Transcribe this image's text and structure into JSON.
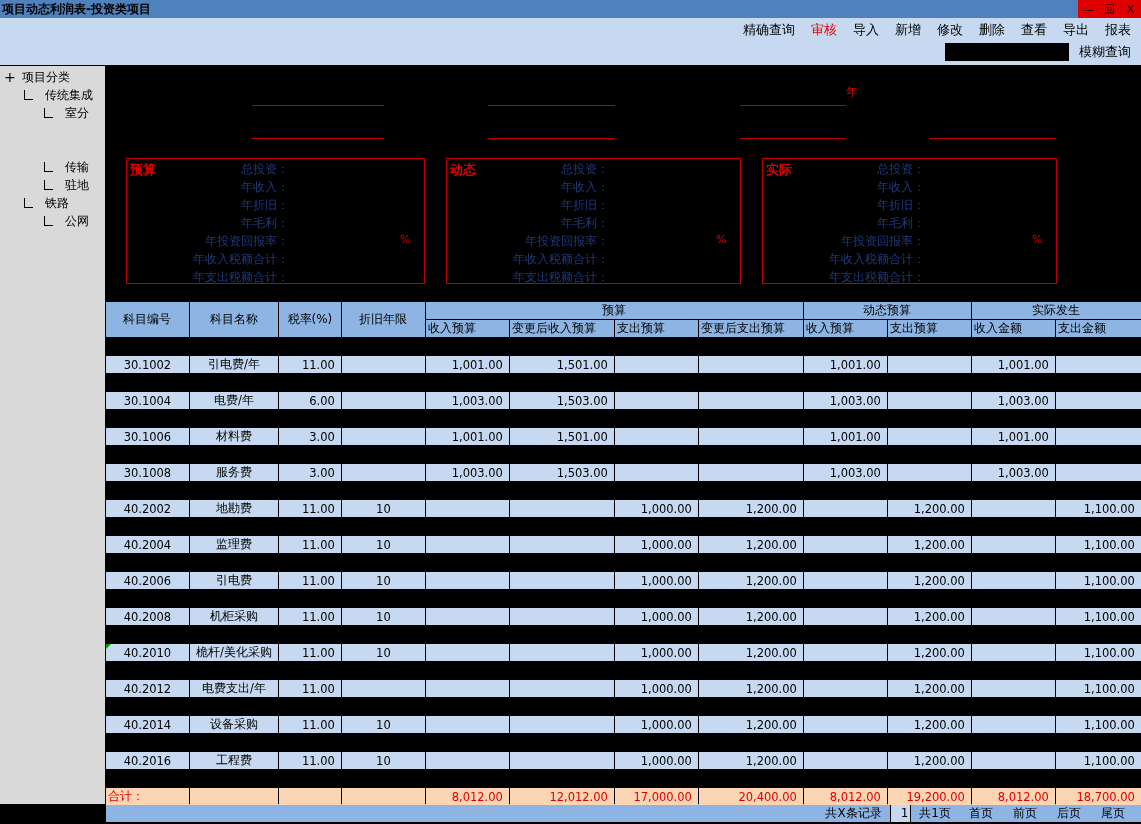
{
  "window": {
    "title": "项目动态利润表-投资类项目",
    "controls": [
      "—",
      "回",
      "X"
    ]
  },
  "toolbar": {
    "buttons": [
      {
        "label": "精确查询",
        "highlighted": false
      },
      {
        "label": "审核",
        "highlighted": true
      },
      {
        "label": "导入",
        "highlighted": false
      },
      {
        "label": "新增",
        "highlighted": false
      },
      {
        "label": "修改",
        "highlighted": false
      },
      {
        "label": "删除",
        "highlighted": false
      },
      {
        "label": "查看",
        "highlighted": false
      },
      {
        "label": "导出",
        "highlighted": false
      },
      {
        "label": "报表",
        "highlighted": false
      }
    ],
    "search_button": "模糊查询"
  },
  "tree": {
    "toggle": "+",
    "label": "项目分类",
    "children": [
      {
        "label": "传统集成",
        "children": [
          {
            "label": "室分"
          },
          {
            "label": "传输"
          },
          {
            "label": "驻地"
          }
        ]
      },
      {
        "label": "铁路",
        "children": [
          {
            "label": "公网"
          }
        ]
      }
    ]
  },
  "header_lines": [
    [
      {
        "kind": "blank"
      },
      {
        "kind": "blank"
      },
      {
        "kind": "year",
        "suffix": "年"
      }
    ],
    [
      {
        "kind": "blank"
      },
      {
        "kind": "blank"
      },
      {
        "kind": "blank"
      },
      {
        "kind": "blank"
      }
    ]
  ],
  "summaries": [
    {
      "title": "预算",
      "fields": [
        {
          "label": "总投资："
        },
        {
          "label": "年收入："
        },
        {
          "label": "年折旧："
        },
        {
          "label": "年毛利："
        },
        {
          "label": "年投资回报率：",
          "unit": "%"
        },
        {
          "label": "年收入税额合计："
        },
        {
          "label": "年支出税额合计："
        }
      ]
    },
    {
      "title": "动态",
      "fields": [
        {
          "label": "总投资："
        },
        {
          "label": "年收入："
        },
        {
          "label": "年折旧："
        },
        {
          "label": "年毛利："
        },
        {
          "label": "年投资回报率：",
          "unit": "%"
        },
        {
          "label": "年收入税额合计："
        },
        {
          "label": "年支出税额合计："
        }
      ]
    },
    {
      "title": "实际",
      "fields": [
        {
          "label": "总投资："
        },
        {
          "label": "年收入："
        },
        {
          "label": "年折旧："
        },
        {
          "label": "年毛利："
        },
        {
          "label": "年投资回报率：",
          "unit": "%"
        },
        {
          "label": "年收入税额合计："
        },
        {
          "label": "年支出税额合计："
        }
      ]
    }
  ],
  "table": {
    "columns": [
      "科目编号",
      "科目名称",
      "税率(%)",
      "折旧年限"
    ],
    "groups": [
      {
        "label": "预算",
        "columns": [
          "收入预算",
          "变更后收入预算",
          "支出预算",
          "变更后支出预算"
        ]
      },
      {
        "label": "动态预算",
        "columns": [
          "收入预算",
          "支出预算"
        ]
      },
      {
        "label": "实际发生",
        "columns": [
          "收入金额",
          "支出金额"
        ]
      }
    ],
    "rows": [
      {
        "marked": false,
        "cells": [
          "30.1002",
          "引电费/年",
          "11.00",
          "",
          "1,001.00",
          "1,501.00",
          "",
          "",
          "1,001.00",
          "",
          "1,001.00",
          ""
        ]
      },
      {
        "marked": false,
        "cells": [
          "30.1004",
          "电费/年",
          "6.00",
          "",
          "1,003.00",
          "1,503.00",
          "",
          "",
          "1,003.00",
          "",
          "1,003.00",
          ""
        ]
      },
      {
        "marked": false,
        "cells": [
          "30.1006",
          "材料费",
          "3.00",
          "",
          "1,001.00",
          "1,501.00",
          "",
          "",
          "1,001.00",
          "",
          "1,001.00",
          ""
        ]
      },
      {
        "marked": false,
        "cells": [
          "30.1008",
          "服务费",
          "3.00",
          "",
          "1,003.00",
          "1,503.00",
          "",
          "",
          "1,003.00",
          "",
          "1,003.00",
          ""
        ]
      },
      {
        "marked": false,
        "cells": [
          "40.2002",
          "地勘费",
          "11.00",
          "10",
          "",
          "",
          "1,000.00",
          "1,200.00",
          "",
          "1,200.00",
          "",
          "1,100.00"
        ]
      },
      {
        "marked": false,
        "cells": [
          "40.2004",
          "监理费",
          "11.00",
          "10",
          "",
          "",
          "1,000.00",
          "1,200.00",
          "",
          "1,200.00",
          "",
          "1,100.00"
        ]
      },
      {
        "marked": false,
        "cells": [
          "40.2006",
          "引电费",
          "11.00",
          "10",
          "",
          "",
          "1,000.00",
          "1,200.00",
          "",
          "1,200.00",
          "",
          "1,100.00"
        ]
      },
      {
        "marked": false,
        "cells": [
          "40.2008",
          "机柜采购",
          "11.00",
          "10",
          "",
          "",
          "1,000.00",
          "1,200.00",
          "",
          "1,200.00",
          "",
          "1,100.00"
        ]
      },
      {
        "marked": true,
        "cells": [
          "40.2010",
          "桅杆/美化采购",
          "11.00",
          "10",
          "",
          "",
          "1,000.00",
          "1,200.00",
          "",
          "1,200.00",
          "",
          "1,100.00"
        ]
      },
      {
        "marked": false,
        "cells": [
          "40.2012",
          "电费支出/年",
          "11.00",
          "",
          "",
          "",
          "1,000.00",
          "1,200.00",
          "",
          "1,200.00",
          "",
          "1,100.00"
        ]
      },
      {
        "marked": false,
        "cells": [
          "40.2014",
          "设备采购",
          "11.00",
          "10",
          "",
          "",
          "1,000.00",
          "1,200.00",
          "",
          "1,200.00",
          "",
          "1,100.00"
        ]
      },
      {
        "marked": false,
        "cells": [
          "40.2016",
          "工程费",
          "11.00",
          "10",
          "",
          "",
          "1,000.00",
          "1,200.00",
          "",
          "1,200.00",
          "",
          "1,100.00"
        ]
      }
    ],
    "total": {
      "label": "合计：",
      "cells": [
        "",
        "",
        "",
        "8,012.00",
        "12,012.00",
        "17,000.00",
        "20,400.00",
        "8,012.00",
        "19,200.00",
        "8,012.00",
        "18,700.00"
      ]
    }
  },
  "footer": {
    "records": "共X条记录",
    "page": "1",
    "pages": "共1页",
    "buttons": [
      "首页",
      "前页",
      "后页",
      "尾页"
    ]
  }
}
